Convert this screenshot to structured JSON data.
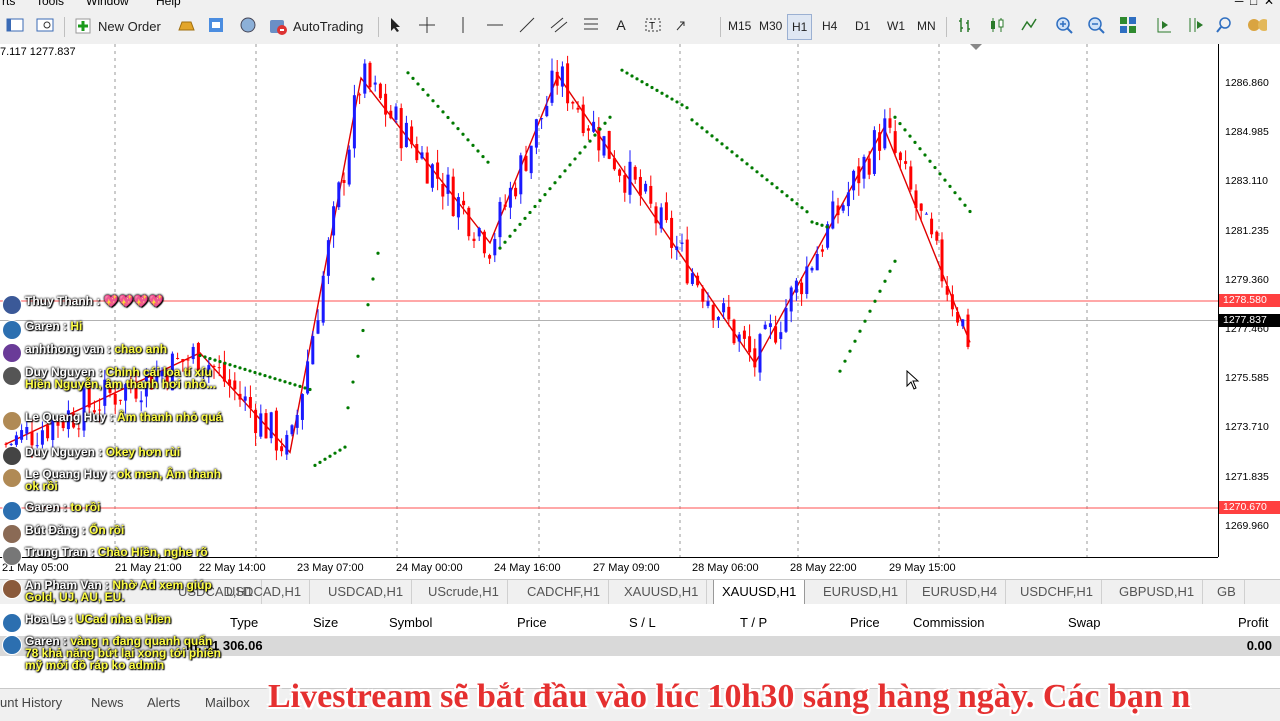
{
  "menu": {
    "items": [
      "rts",
      "Tools",
      "Window",
      "Help"
    ]
  },
  "toolbar": {
    "new_order": "New Order",
    "autotrading": "AutoTrading",
    "timeframes": [
      "M15",
      "M30",
      "H1",
      "H4",
      "D1",
      "W1",
      "MN"
    ],
    "active_timeframe": "H1"
  },
  "chart": {
    "ohlc_label": "7.117 1277.837",
    "symbol": "XAUUSD,H1",
    "price_labels": [
      "1286.860",
      "1284.985",
      "1283.110",
      "1281.235",
      "1279.360",
      "1277.460",
      "1275.585",
      "1273.710",
      "1271.835",
      "1269.960"
    ],
    "current_price": "1277.837",
    "level_upper": "1278.580",
    "level_lower": "1270.670",
    "time_labels": [
      "21 May 05:00",
      "21 May 21:00",
      "22 May 14:00",
      "23 May 07:00",
      "24 May 00:00",
      "24 May 16:00",
      "27 May 09:00",
      "28 May 06:00",
      "28 May 22:00",
      "29 May 15:00"
    ],
    "colors": {
      "bull": "#1a1aff",
      "bear": "#ff0000",
      "zigzag": "#e00000",
      "sar": "#007a00",
      "level": "#ff5050"
    }
  },
  "chart_data": {
    "type": "candlestick",
    "title": "XAUUSD,H1",
    "xlabel": "",
    "ylabel": "",
    "ylim": [
      1268.8,
      1288.4
    ],
    "x": [
      "21 May 05:00",
      "21 May 21:00",
      "22 May 14:00",
      "23 May 07:00",
      "24 May 00:00",
      "24 May 16:00",
      "27 May 09:00",
      "28 May 06:00",
      "28 May 22:00",
      "29 May 15:00"
    ],
    "zigzag_pivots": [
      1273.1,
      1276.6,
      1272.8,
      1287.1,
      1280.8,
      1287.2,
      1276.2,
      1285.2,
      1277.0
    ],
    "horizontal_levels": [
      1278.58,
      1270.67
    ],
    "last_price": 1277.837
  },
  "symbol_tabs": [
    "USDCAD,H1",
    "USDCAD,H1",
    "USDCAD,H1",
    "UScrude,H1",
    "CADCHF,H1",
    "XAUUSD,H1",
    "XAUUSD,H1",
    "EURUSD,H1",
    "EURUSD,H4",
    "USDCHF,H1",
    "GBPUSD,H1",
    "GB"
  ],
  "active_tab_index": 6,
  "terminal": {
    "headers": [
      "Type",
      "Size",
      "Symbol",
      "Price",
      "S / L",
      "T / P",
      "Price",
      "Commission",
      "Swap",
      "Profit"
    ],
    "balance_text": "in: 11 306.06",
    "profit_total": "0.00"
  },
  "bottom_tabs": [
    "unt History",
    "News",
    "Alerts",
    "Mailbox"
  ],
  "chat": [
    {
      "name": "Thuy Thanh :",
      "message": "💖💖💖💖"
    },
    {
      "name": "Garen :",
      "message": "Hi"
    },
    {
      "name": "anhthong van :",
      "message": "chao anh"
    },
    {
      "name": "Duy Nguyen :",
      "message": "Chỉnh cái loa tí xíu Hiền Nguyễn, âm thanh hơi nhỏ..."
    },
    {
      "name": "Le Quang Huy :",
      "message": "Âm thanh nhỏ quá"
    },
    {
      "name": "Duy Nguyen :",
      "message": "Okey hơn rùi"
    },
    {
      "name": "Le Quang Huy :",
      "message": "ok men, Âm thanh ok rồi"
    },
    {
      "name": "Garen :",
      "message": "to rồi"
    },
    {
      "name": "Bút Đăng :",
      "message": "Ổn rồi"
    },
    {
      "name": "Trung Tran :",
      "message": "Chào Hiền, nghe rõ"
    },
    {
      "name": "An Pham Van :",
      "message": "Nhờ Ad xem giúp Gold, UJ, AU, EU."
    },
    {
      "name": "Hoa Le :",
      "message": "UCad nha a Hien"
    },
    {
      "name": "Garen :",
      "message": "vàng n đang quanh quẩn 78 khả năng bứt lại xong tới phiên mỹ mới đồ ráp ko admin"
    }
  ],
  "banner": "Livestream sẽ bắt đầu vào lúc 10h30 sáng hàng ngày. Các bạn n"
}
